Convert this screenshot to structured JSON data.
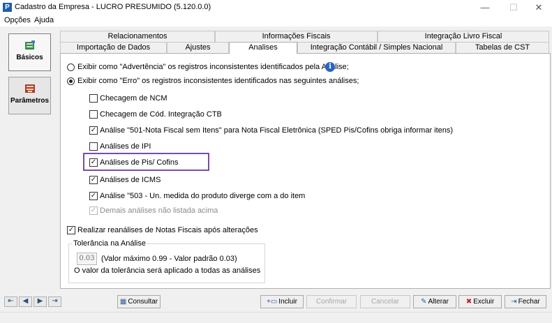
{
  "window": {
    "title": "Cadastro da Empresa - LUCRO PRESUMIDO (5.120.0.0)",
    "icon_glyph": "P",
    "controls": {
      "minimize": "—",
      "maximize": "☐",
      "close": "✕"
    }
  },
  "menu": {
    "items": [
      "Opções",
      "Ajuda"
    ]
  },
  "sidebar": {
    "items": [
      {
        "label": "Básicos",
        "icon": "basics-icon",
        "active": true
      },
      {
        "label": "Parâmetros",
        "icon": "parameters-icon",
        "active": false
      }
    ]
  },
  "tabs": {
    "row1": [
      "Relacionamentos",
      "Informações Fiscais",
      "Integração Livro Fiscal"
    ],
    "row2": [
      "Importação de Dados",
      "Ajustes",
      "Analises",
      "Integração Contábil / Simples Nacional",
      "Tabelas de CST"
    ],
    "active": "Analises"
  },
  "analises": {
    "radio_warning": "Exibir como \"Advertência\" os registros inconsistentes identificados pela Análise;",
    "radio_error": "Exibir como \"Erro\" os registros inconsistentes identificados nas seguintes análises;",
    "selected_radio": "error",
    "checks": [
      {
        "label": "Checagem de NCM",
        "checked": false,
        "disabled": false
      },
      {
        "label": "Checagem de Cód. Integração CTB",
        "checked": false,
        "disabled": false
      },
      {
        "label": "Análise \"501-Nota Fiscal sem Itens\" para Nota Fiscal Eletrônica (SPED Pis/Cofins obriga informar itens)",
        "checked": true,
        "disabled": false
      },
      {
        "label": "Análises de IPI",
        "checked": false,
        "disabled": false
      },
      {
        "label": "Análises de Pis/ Cofins",
        "checked": true,
        "disabled": false
      },
      {
        "label": "Análises de ICMS",
        "checked": true,
        "disabled": false
      },
      {
        "label": "Análise \"503 - Un. medida do produto diverge com a do item",
        "checked": true,
        "disabled": false
      },
      {
        "label": "Demais análises não listada acima",
        "checked": true,
        "disabled": true
      }
    ],
    "reanalyze_label": "Realizar reanálises de Notas Fiscais após alterações",
    "reanalyze_checked": true,
    "tolerance": {
      "title": "Tolerância na Análise",
      "value": "0.03",
      "hint": "(Valor máximo 0.99 - Valor padrão 0.03)",
      "note": "O valor da tolerância será aplicado a todas as análises"
    }
  },
  "footer": {
    "nav": [
      "⇤",
      "◀",
      "▶",
      "⇥"
    ],
    "consultar": "Consultar",
    "incluir": "Incluir",
    "confirmar": "Confirmar",
    "cancelar": "Cancelar",
    "alterar": "Alterar",
    "excluir": "Excluir",
    "fechar": "Fechar"
  },
  "colors": {
    "highlight": "#7a4bb0",
    "info": "#2a64c5"
  }
}
